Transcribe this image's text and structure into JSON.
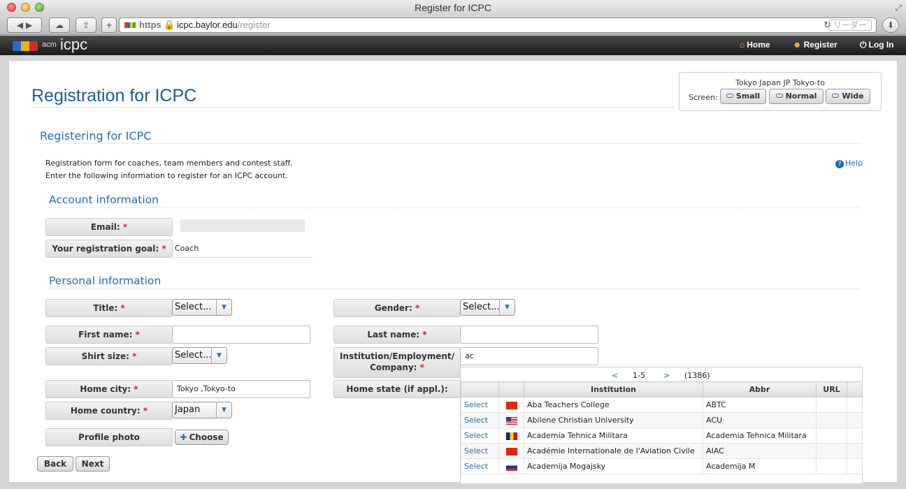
{
  "window": {
    "title": "Register for ICPC"
  },
  "browser": {
    "url_protocol": "https",
    "url_host": "icpc.baylor.edu",
    "url_path": "/register",
    "reader_label": "リーダー",
    "back_icon": "back-arrow-icon",
    "forward_icon": "forward-arrow-icon"
  },
  "site_nav": {
    "logo_acm": "acm",
    "logo_icpc": "icpc",
    "home": "Home",
    "register": "Register",
    "login": "Log In"
  },
  "page": {
    "title": "Registration for ICPC",
    "subtitle": "Registering for ICPC",
    "intro_line1": "Registration form for coaches, team members and contest staff.",
    "intro_line2": "Enter the following information to register for an ICPC account.",
    "help_label": "Help"
  },
  "screen_box": {
    "location": "Tokyo Japan JP Tokyo-to",
    "label": "Screen:",
    "small": "Small",
    "normal": "Normal",
    "wide": "Wide"
  },
  "account": {
    "heading": "Account information",
    "email_label": "Email:",
    "goal_label": "Your registration goal:",
    "goal_value": "Coach"
  },
  "personal": {
    "heading": "Personal information",
    "title_label": "Title:",
    "title_value": "Select...",
    "gender_label": "Gender:",
    "gender_value": "Select...",
    "first_name_label": "First name:",
    "last_name_label": "Last name:",
    "shirt_label": "Shirt size:",
    "shirt_value": "Select...",
    "institution_label_1": "Institution/Employment/",
    "institution_label_2": "Company:",
    "institution_value": "ac",
    "home_city_label": "Home city:",
    "home_city_value": "Tokyo ,Tokyo-to",
    "home_state_label": "Home state (if appl.):",
    "home_country_label": "Home country:",
    "home_country_value": "Japan",
    "photo_label": "Profile photo",
    "choose_label": "Choose",
    "required_mark": "*"
  },
  "buttons": {
    "back": "Back",
    "next": "Next"
  },
  "institution_results": {
    "prev": "<",
    "range": "1-5",
    "next": ">",
    "total": "(1386)",
    "columns": [
      "Institution",
      "Abbr",
      "URL"
    ],
    "rows": [
      {
        "action": "Select",
        "flag": "china",
        "name": "Aba Teachers College",
        "abbr": "ABTC"
      },
      {
        "action": "Select",
        "flag": "usa",
        "name": "Abilene Christian University",
        "abbr": "ACU"
      },
      {
        "action": "Select",
        "flag": "romania",
        "name": "Academia Tehnica Militara",
        "abbr": "Academia Tehnica Militara"
      },
      {
        "action": "Select",
        "flag": "china",
        "name": "Académie Internationale de l'Aviation Civile",
        "abbr": "AIAC"
      },
      {
        "action": "Select",
        "flag": "russia",
        "name": "Academija Mogajsky",
        "abbr": "Academija M"
      }
    ]
  }
}
